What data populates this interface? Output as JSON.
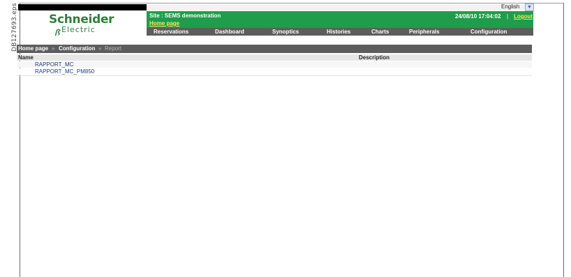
{
  "figure_label": "DB127693.eps",
  "header": {
    "language": "English",
    "site": "Site : SEMS demonstration",
    "home_link": "Home page",
    "datetime": "24/08/10 17:04:02",
    "separator": "|",
    "logout": "Logout",
    "logo": {
      "top": "Schneider",
      "bottom": "Electric"
    }
  },
  "nav": {
    "items": [
      "Reservations",
      "Dashboard",
      "Synoptics",
      "Histories",
      "Charts",
      "Peripherals",
      "Configuration"
    ]
  },
  "breadcrumb": {
    "home": "Home page",
    "arrow": "»",
    "config": "Configuration",
    "report": "Report"
  },
  "table": {
    "headers": {
      "name": "Name",
      "description": "Description"
    },
    "rows": [
      {
        "name": "RAPPORT_MC",
        "description": ""
      },
      {
        "name": "RAPPORT_MC_PM850",
        "description": ""
      }
    ]
  }
}
